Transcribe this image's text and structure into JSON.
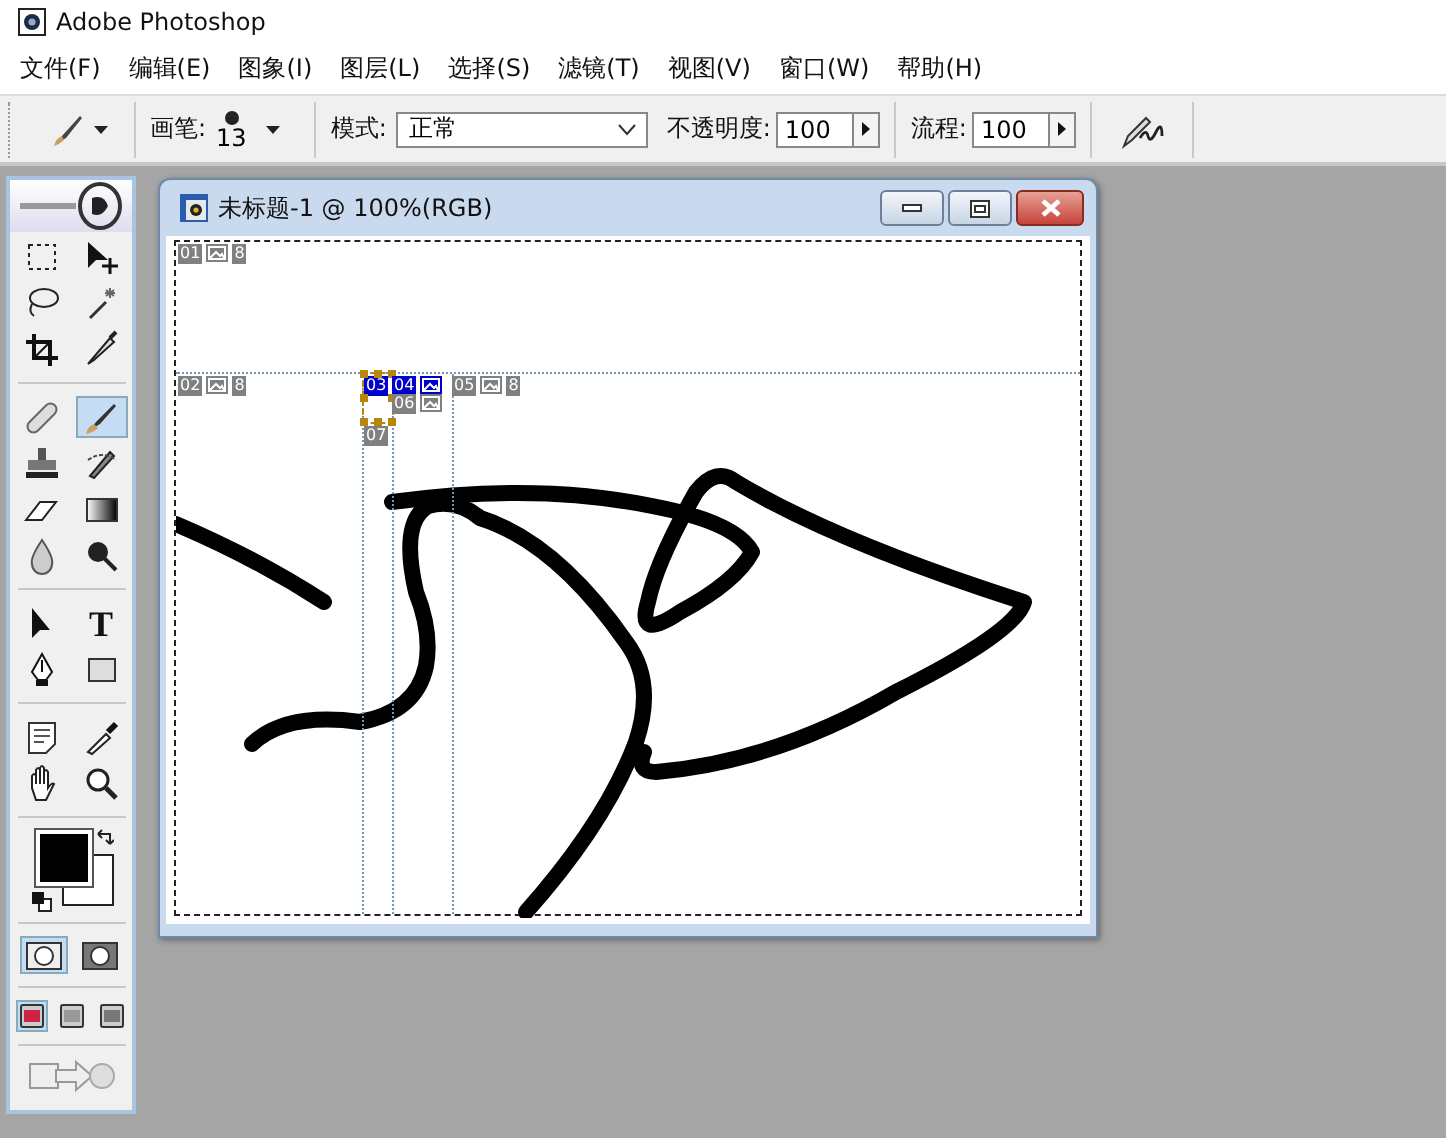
{
  "app": {
    "title": "Adobe Photoshop"
  },
  "menu": [
    "文件(F)",
    "编辑(E)",
    "图象(I)",
    "图层(L)",
    "选择(S)",
    "滤镜(T)",
    "视图(V)",
    "窗口(W)",
    "帮助(H)"
  ],
  "options_bar": {
    "brush_label": "画笔:",
    "brush_size": "13",
    "mode_label": "模式:",
    "mode_value": "正常",
    "opacity_label": "不透明度:",
    "opacity_value": "100",
    "flow_label": "流程:",
    "flow_value": "100",
    "airbrush_on": false
  },
  "toolbox": {
    "tools": [
      {
        "selected": false
      },
      {
        "selected": false
      },
      {
        "selected": false
      },
      {
        "selected": false
      },
      {
        "selected": false
      },
      {
        "selected": false
      },
      {
        "selected": false
      },
      {
        "selected": true
      },
      {
        "selected": false
      },
      {
        "selected": false
      },
      {
        "selected": false
      },
      {
        "selected": false
      },
      {
        "selected": false
      },
      {
        "selected": false
      },
      {
        "selected": false
      },
      {
        "selected": false,
        "glyph": "T"
      },
      {
        "selected": false
      },
      {
        "selected": false
      },
      {
        "selected": false
      },
      {
        "selected": false
      },
      {
        "selected": false
      },
      {
        "selected": false
      }
    ],
    "mask_modes": [
      {
        "selected": true
      },
      {
        "selected": false
      }
    ],
    "screen_modes": [
      {
        "selected": true
      },
      {
        "selected": false
      },
      {
        "selected": false
      }
    ]
  },
  "document": {
    "title": "未标题-1 @ 100%(RGB)",
    "slices": [
      {
        "number": "01",
        "icon": true,
        "badge": "8",
        "selected": false,
        "highlighted": false
      },
      {
        "number": "02",
        "icon": true,
        "badge": "8",
        "selected": false,
        "highlighted": false
      },
      {
        "number": "03",
        "icon": false,
        "selected": true,
        "highlighted": true
      },
      {
        "number": "04",
        "icon": true,
        "selected": false,
        "highlighted": true
      },
      {
        "number": "05",
        "icon": true,
        "badge": "8",
        "selected": false,
        "highlighted": false
      },
      {
        "number": "06",
        "icon": true,
        "selected": false,
        "highlighted": false
      },
      {
        "number": "07",
        "icon": false,
        "selected": false,
        "highlighted": false
      }
    ]
  }
}
